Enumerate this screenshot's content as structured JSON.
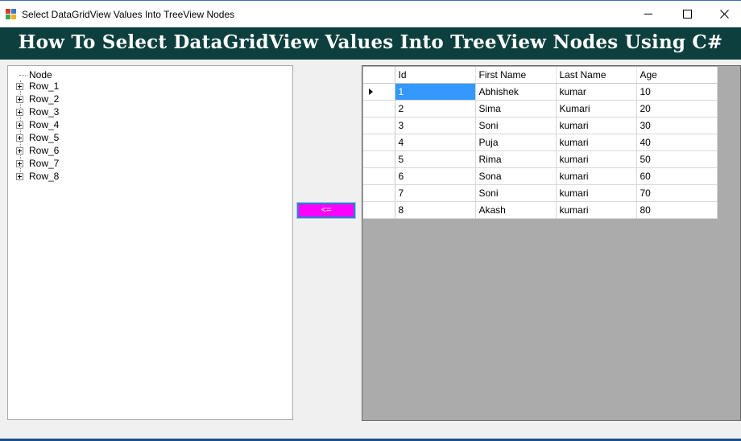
{
  "window": {
    "title": "Select DataGridView Values Into TreeView Nodes",
    "controls": [
      "minimize",
      "maximize",
      "close"
    ]
  },
  "header": {
    "title": "How To Select DataGridView Values Into TreeView Nodes Using C#",
    "background": "#0c3f3d"
  },
  "tree": {
    "root": "Node",
    "nodes": [
      "Row_1",
      "Row_2",
      "Row_3",
      "Row_4",
      "Row_5",
      "Row_6",
      "Row_7",
      "Row_8"
    ]
  },
  "transfer_button": {
    "label": "<=",
    "color": "#ff00ff"
  },
  "grid": {
    "columns": [
      "Id",
      "First Name",
      "Last Name",
      "Age"
    ],
    "rows": [
      [
        "1",
        "Abhishek",
        "kumar",
        "10"
      ],
      [
        "2",
        "Sima",
        "Kumari",
        "20"
      ],
      [
        "3",
        "Soni",
        "kumari",
        "30"
      ],
      [
        "4",
        "Puja",
        "kumari",
        "40"
      ],
      [
        "5",
        "Rima",
        "kumari",
        "50"
      ],
      [
        "6",
        "Sona",
        "kumari",
        "60"
      ],
      [
        "7",
        "Soni",
        "kumari",
        "70"
      ],
      [
        "8",
        "Akash",
        "kumari",
        "80"
      ]
    ],
    "selected_row": 0,
    "selected_color": "#3399ff"
  }
}
